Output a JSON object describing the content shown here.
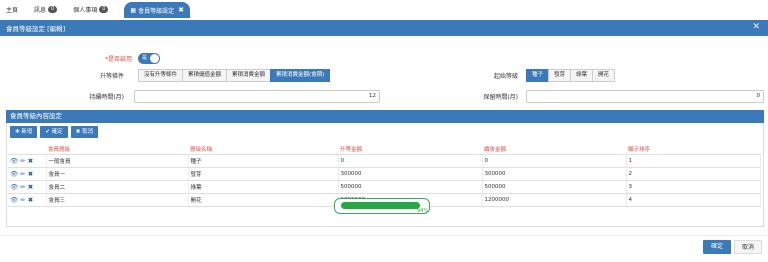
{
  "nav": {
    "home": "主頁",
    "inbox": "訊息",
    "inbox_count": "0",
    "personal": "個人事項",
    "personal_count": "0",
    "active_tab": "會員等級設定"
  },
  "dialog": {
    "title": "會員等級設定 [編輯]"
  },
  "form": {
    "enabled_label": "*是否啟用",
    "enabled_value": "是",
    "upgrade_label": "升等條件",
    "upgrade_options": [
      "沒有升等條件",
      "累積儲值金額",
      "累積消費金額",
      "累積消費金額(會期)"
    ],
    "upgrade_active_index": 3,
    "start_level_label": "起始等級",
    "start_level_options": [
      "種子",
      "發芽",
      "綠葉",
      "開花"
    ],
    "start_level_active_index": 0,
    "maintain_label": "持續時間(月)",
    "maintain_value": "12",
    "grace_label": "保留時間(月)",
    "grace_value": "0"
  },
  "section": {
    "title": "會員等級內容設定",
    "add": "新增",
    "confirm": "確定",
    "cancel": "取消"
  },
  "table": {
    "headers": [
      "會員層級",
      "層級名稱",
      "升等金額",
      "續會金額",
      "顯示排序"
    ],
    "rows": [
      [
        "一般會員",
        "種子",
        "0",
        "0",
        "1"
      ],
      [
        "會員一",
        "發芽",
        "300000",
        "300000",
        "2"
      ],
      [
        "會員二",
        "綠葉",
        "500000",
        "500000",
        "3"
      ],
      [
        "會員三",
        "開花",
        "1200000",
        "1200000",
        "4"
      ]
    ]
  },
  "progress": {
    "value": 0.94,
    "label": "94%"
  },
  "footer": {
    "ok": "確定",
    "cancel": "取消"
  }
}
